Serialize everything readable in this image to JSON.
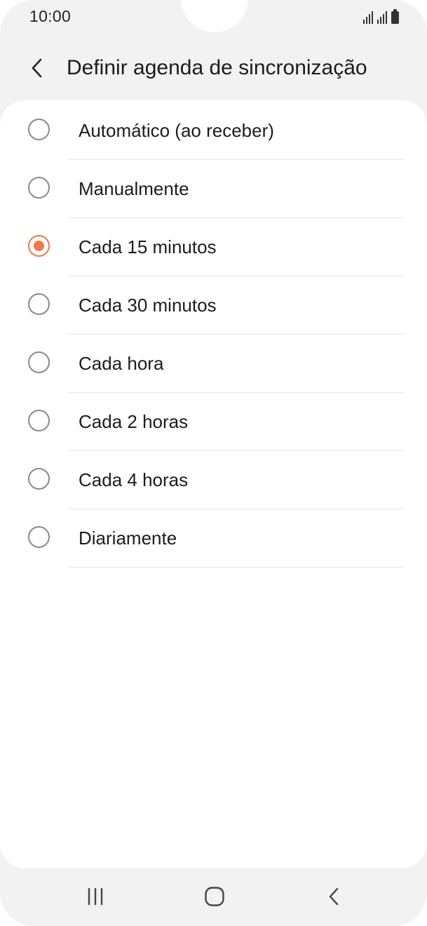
{
  "status_bar": {
    "time": "10:00",
    "icons": [
      "signal-icon",
      "signal-icon",
      "battery-icon"
    ]
  },
  "header": {
    "title": "Definir agenda de sincronização",
    "back_icon": "chevron-left-icon"
  },
  "accent_color": "#f0784b",
  "options": [
    {
      "label": "Automático (ao receber)",
      "selected": false
    },
    {
      "label": "Manualmente",
      "selected": false
    },
    {
      "label": "Cada 15 minutos",
      "selected": true
    },
    {
      "label": "Cada 30 minutos",
      "selected": false
    },
    {
      "label": "Cada hora",
      "selected": false
    },
    {
      "label": "Cada 2 horas",
      "selected": false
    },
    {
      "label": "Cada 4 horas",
      "selected": false
    },
    {
      "label": "Diariamente",
      "selected": false
    }
  ],
  "nav_bar": {
    "buttons": [
      "recent-apps-icon",
      "home-icon",
      "back-icon"
    ]
  }
}
